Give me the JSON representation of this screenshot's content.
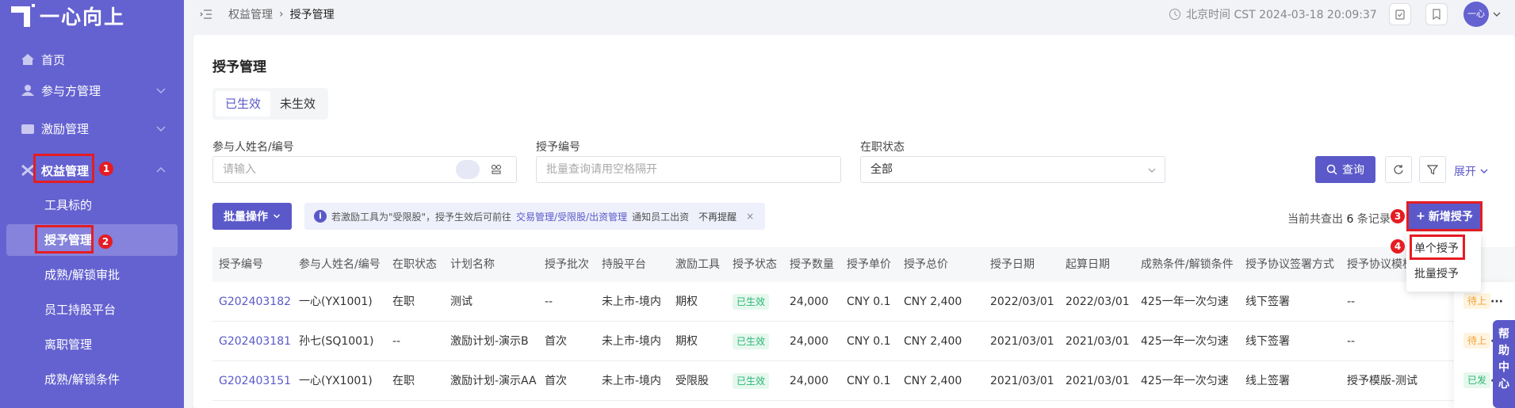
{
  "brand": {
    "logo_text": "一心向上"
  },
  "sidebar": {
    "items": [
      {
        "label": "首页"
      },
      {
        "label": "参与方管理"
      },
      {
        "label": "激励管理"
      },
      {
        "label": "权益管理"
      }
    ],
    "subitems": [
      {
        "label": "工具标的"
      },
      {
        "label": "授予管理"
      },
      {
        "label": "成熟/解锁审批"
      },
      {
        "label": "员工持股平台"
      },
      {
        "label": "离职管理"
      },
      {
        "label": "成熟/解锁条件"
      }
    ]
  },
  "markers": [
    "1",
    "2",
    "3",
    "4"
  ],
  "topbar": {
    "breadcrumb": [
      "权益管理",
      "授予管理"
    ],
    "time": "北京时间 CST 2024-03-18 20:09:37",
    "avatar": "一心"
  },
  "page": {
    "title": "授予管理",
    "tabs": [
      "已生效",
      "未生效"
    ]
  },
  "filters": {
    "participant": {
      "label": "参与人姓名/编号",
      "placeholder": "请输入"
    },
    "grant_no": {
      "label": "授予编号",
      "placeholder": "批量查询请用空格隔开"
    },
    "status": {
      "label": "在职状态",
      "value": "全部"
    },
    "query": "查询",
    "expand": "展开"
  },
  "actions": {
    "batch": "批量操作",
    "tip_prefix": "若激励工具为\"受限股\"，授予生效后可前往",
    "tip_link": "交易管理/受限股/出资管理",
    "tip_suffix": "通知员工出资",
    "tip_dismiss": "不再提醒",
    "count_prefix": "当前共查出",
    "count_value": "6",
    "count_suffix": "条记录",
    "add": "新增授予",
    "dropdown": [
      "单个授予",
      "批量授予"
    ]
  },
  "table": {
    "headers": [
      "授予编号",
      "参与人姓名/编号",
      "在职状态",
      "计划名称",
      "授予批次",
      "持股平台",
      "激励工具",
      "授予状态",
      "授予数量",
      "授予单价",
      "授予总价",
      "授予日期",
      "起算日期",
      "成熟条件/解锁条件",
      "授予协议签署方式",
      "授予协议模板"
    ],
    "rows": [
      {
        "no": "G202403182",
        "name": "一心(YX1001)",
        "emp": "在职",
        "plan": "测试",
        "batch": "--",
        "platform": "未上市-境内",
        "tool": "期权",
        "status": "已生效",
        "qty": "24,000",
        "price": "CNY  0.1",
        "total": "CNY  2,400",
        "date": "2022/03/01",
        "start": "2022/03/01",
        "cond": "425一年一次匀速",
        "sign": "线下签署",
        "tmpl": "--",
        "tag": "待上"
      },
      {
        "no": "G202403181",
        "name": "孙七(SQ1001)",
        "emp": "--",
        "plan": "激励计划-演示B",
        "batch": "首次",
        "platform": "未上市-境内",
        "tool": "期权",
        "status": "已生效",
        "qty": "24,000",
        "price": "CNY  0.1",
        "total": "CNY  2,400",
        "date": "2021/03/01",
        "start": "2021/03/01",
        "cond": "425一年一次匀速",
        "sign": "线下签署",
        "tmpl": "--",
        "tag": "待上"
      },
      {
        "no": "G202403151",
        "name": "一心(YX1001)",
        "emp": "在职",
        "plan": "激励计划-演示AA",
        "batch": "首次",
        "platform": "未上市-境内",
        "tool": "受限股",
        "status": "已生效",
        "qty": "24,000",
        "price": "CNY  0.1",
        "total": "CNY  2,400",
        "date": "2021/03/01",
        "start": "2021/03/01",
        "cond": "425一年一次匀速",
        "sign": "线上签署",
        "tmpl": "授予模版-测试",
        "tag": "已发"
      }
    ],
    "more": "···"
  },
  "help": "帮助中心"
}
